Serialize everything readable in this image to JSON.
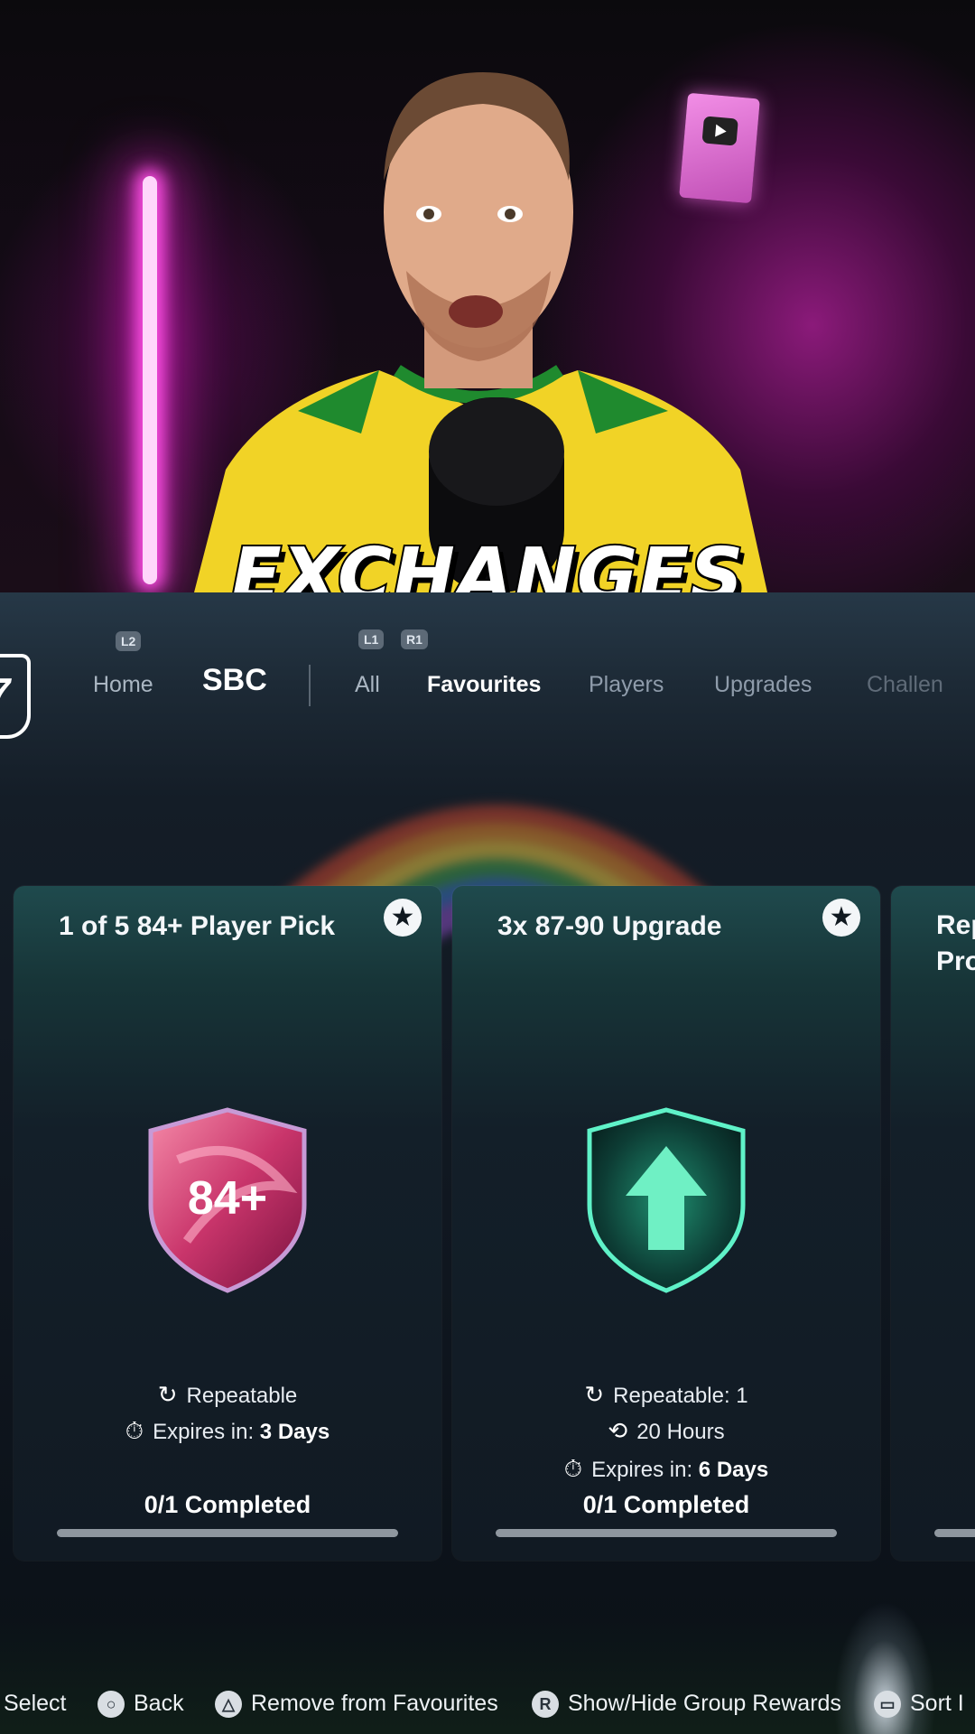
{
  "video": {
    "caption": "EXCHANGES"
  },
  "nav": {
    "logo_text": "7",
    "l2_hint": "L2",
    "l1_hint": "L1",
    "r1_hint": "R1",
    "home": "Home",
    "sbc": "SBC",
    "tabs": [
      "All",
      "Favourites",
      "Players",
      "Upgrades",
      "Challen"
    ]
  },
  "cards": [
    {
      "title": "1 of 5 84+ Player Pick",
      "badge_text": "84+",
      "repeatable": "Repeatable",
      "expires_label": "Expires in:",
      "expires_value": "3 Days",
      "completed": "0/1 Completed",
      "progress": 0
    },
    {
      "title": "3x 87-90 Upgrade",
      "repeatable": "Repeatable: 1",
      "refresh": "20 Hours",
      "expires_label": "Expires in:",
      "expires_value": "6 Days",
      "completed": "0/1 Completed",
      "progress": 0
    },
    {
      "title": "Rep\nPro"
    }
  ],
  "footer": {
    "select": "Select",
    "back": "Back",
    "remove": "Remove from Favourites",
    "show_hide": "Show/Hide Group Rewards",
    "sort": "Sort I",
    "r_hint": "R"
  },
  "icons": {
    "favourite": "star-icon",
    "repeat": "repeat-icon",
    "timer": "stopwatch-icon",
    "refresh": "history-icon"
  },
  "colors": {
    "badge_pink": "#d64a7c",
    "badge_green": "#5ff2c8",
    "accent_white": "#ffffff"
  }
}
